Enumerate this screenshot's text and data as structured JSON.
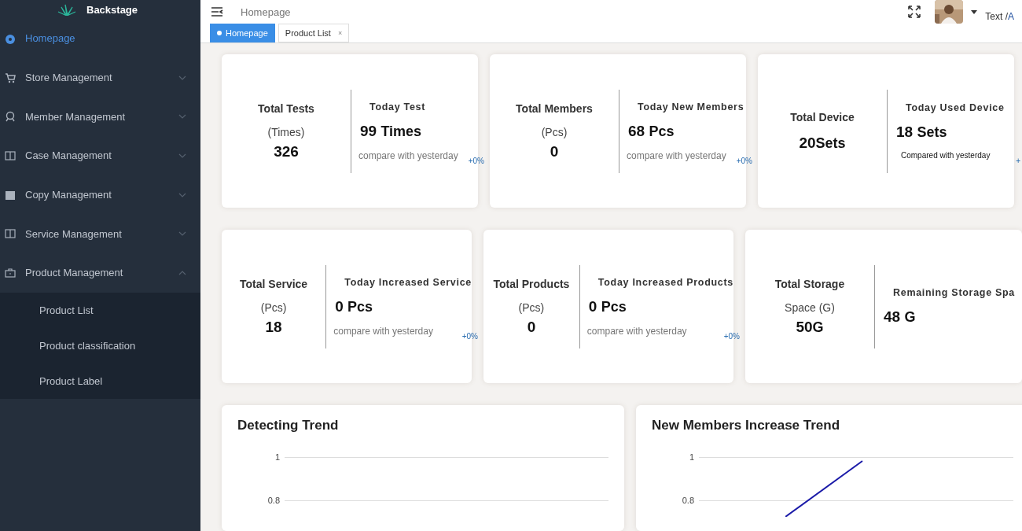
{
  "sidebar": {
    "brand": "Backstage",
    "items": [
      {
        "label": "Homepage",
        "selected": true
      },
      {
        "label": "Store Management",
        "selected": false,
        "expanded": false
      },
      {
        "label": "Member Management",
        "selected": false,
        "expanded": false
      },
      {
        "label": "Case Management",
        "selected": false,
        "expanded": false
      },
      {
        "label": "Copy Management",
        "selected": false,
        "expanded": false
      },
      {
        "label": "Service Management",
        "selected": false,
        "expanded": false
      },
      {
        "label": "Product Management",
        "selected": false,
        "expanded": true,
        "children": [
          {
            "label": "Product List",
            "selected": false
          },
          {
            "label": "Product classification",
            "selected": false
          },
          {
            "label": "Product Label",
            "selected": false
          }
        ]
      }
    ]
  },
  "header": {
    "breadcrumb": "Homepage",
    "text_label": "Text / ",
    "text_link": "A"
  },
  "tabs": [
    {
      "label": "Homepage",
      "selected": true,
      "closable": false
    },
    {
      "label": "Product List",
      "selected": false,
      "closable": true,
      "close": "×"
    }
  ],
  "stat_cards": [
    [
      {
        "left": {
          "title": "Total Tests",
          "unit": "(Times)",
          "value": "326"
        },
        "right": {
          "title": "Today Test",
          "value": "99",
          "unit": "Times",
          "compare": "compare with yesterday",
          "small": false
        },
        "change": "+0%"
      },
      {
        "left": {
          "title": "Total Members",
          "unit": "(Pcs)",
          "value": "0"
        },
        "right": {
          "title": "Today New Members",
          "value": "68",
          "unit": "Pcs",
          "compare": "compare with yesterday",
          "small": false
        },
        "change": "+0%"
      },
      {
        "left": {
          "title": "Total Device",
          "value": "20",
          "value_unit": "Sets"
        },
        "right": {
          "title": "Today Used Device",
          "value": "18",
          "unit": "Sets",
          "compare": "Compared with yesterday",
          "small": true
        },
        "change": "+"
      }
    ],
    [
      {
        "left": {
          "title": "Total Service",
          "unit": "(Pcs)",
          "value": "18"
        },
        "right": {
          "title": "Today Increased Service",
          "value": "0",
          "unit": "Pcs",
          "compare": "compare with yesterday",
          "small": false
        },
        "change": "+0%"
      },
      {
        "left": {
          "title": "Total Products",
          "unit": "(Pcs)",
          "value": "0"
        },
        "right": {
          "title": "Today Increased Products",
          "value": "0",
          "unit": "Pcs",
          "compare": "compare with yesterday",
          "small": false
        },
        "change": "+0%"
      },
      {
        "left": {
          "title": "Total Storage",
          "unit": "Space  (G)",
          "value": "50",
          "value_unit": "G"
        },
        "right": {
          "title": "Remaining Storage Spa",
          "value": "48",
          "unit": "G"
        }
      }
    ]
  ],
  "charts": [
    {
      "title": "Detecting Trend",
      "y_labels": [
        "1",
        "0.8"
      ]
    },
    {
      "title": "New Members Increase Trend",
      "y_labels": [
        "1",
        "0.8"
      ],
      "kind": "picture"
    }
  ]
}
